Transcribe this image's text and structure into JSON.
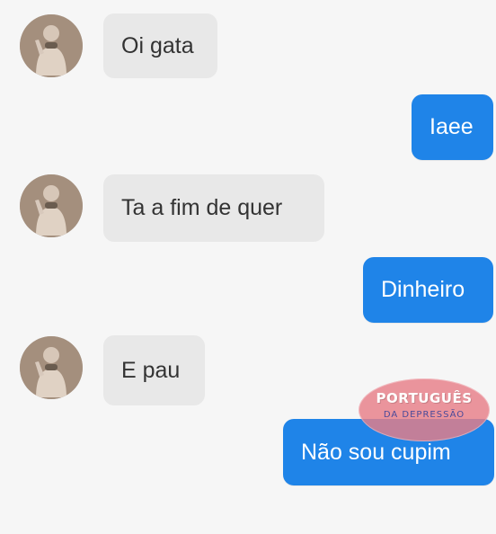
{
  "messages": [
    {
      "side": "incoming",
      "text": "Oi gata"
    },
    {
      "side": "outgoing",
      "text": "Iaee"
    },
    {
      "side": "incoming",
      "text": "Ta a fim de quer"
    },
    {
      "side": "outgoing",
      "text": "Dinheiro"
    },
    {
      "side": "incoming",
      "text": "E pau"
    },
    {
      "side": "outgoing",
      "text": "Não sou cupim"
    }
  ],
  "watermark": {
    "title": "PORTUGUÊS",
    "subtitle": "DA DEPRESSÃO"
  },
  "colors": {
    "background": "#f6f6f6",
    "incoming_bubble": "#e8e8e8",
    "outgoing_bubble": "#1f84e8",
    "watermark": "#e77e88"
  }
}
